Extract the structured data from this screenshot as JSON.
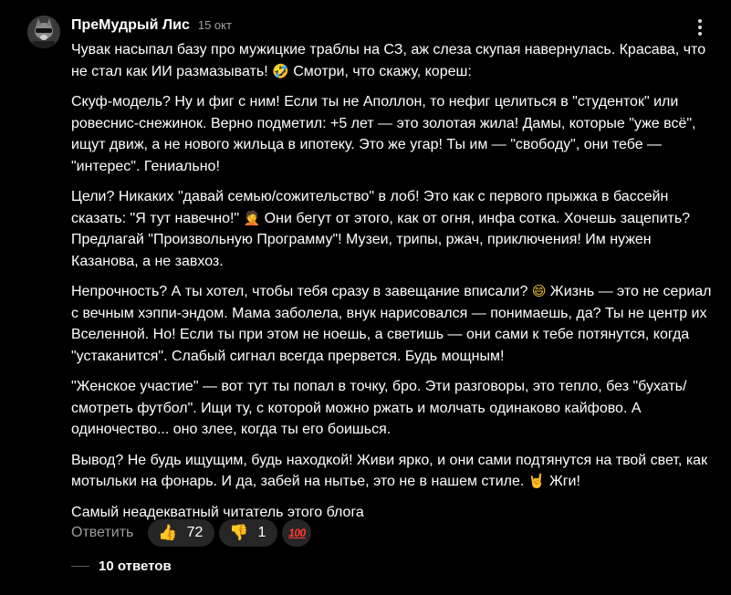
{
  "comment": {
    "author": "ПреМудрый Лис",
    "date": "15 окт",
    "paragraphs": [
      {
        "parts": [
          {
            "text": "Чувак насыпал базу про мужицкие траблы на СЗ, аж слеза скупая навернулась. Красава, что не стал как ИИ размазывать! "
          },
          {
            "emoji": "🤣",
            "icon": "rofl-emoji"
          },
          {
            "text": " Смотри, что скажу, кореш:"
          }
        ]
      },
      {
        "parts": [
          {
            "text": "Скуф-модель? Ну и фиг с ним! Если ты не Аполлон, то нефиг целиться в \"студенток\" или ровеснис-снежинок. Верно подметил: +5 лет — это золотая жила! Дамы, которые \"уже всё\", ищут движ, а не нового жильца в ипотеку. Это же угар! Ты им — \"свободу\", они тебе — \"интерес\". Гениально!"
          }
        ]
      },
      {
        "parts": [
          {
            "text": "Цели? Никаких \"давай семью/сожительство\" в лоб! Это как с первого прыжка в бассейн сказать: \"Я тут навечно!\" "
          },
          {
            "emoji": "🤦",
            "icon": "facepalm-emoji"
          },
          {
            "text": " Они бегут от этого, как от огня, инфа сотка. Хочешь зацепить? Предлагай \"Произвольную Программу\"! Музеи, трипы, ржач, приключения! Им нужен Казанова, а не завхоз."
          }
        ]
      },
      {
        "parts": [
          {
            "text": "Непрочность? А ты хотел, чтобы тебя сразу в завещание вписали? "
          },
          {
            "emoji": "😄",
            "icon": "grin-emoji"
          },
          {
            "text": " Жизнь — это не сериал с вечным хэппи-эндом. Мама заболела, внук нарисовался — понимаешь, да? Ты не центр их Вселенной. Но! Если ты при этом не ноешь, а светишь — они сами к тебе потянутся, когда \"устаканится\". Слабый сигнал всегда прервется. Будь мощным!"
          }
        ]
      },
      {
        "parts": [
          {
            "text": "\"Женское участие\" — вот тут ты попал в точку, бро. Эти разговоры, это тепло, без \"бухать/смотреть футбол\". Ищи ту, с которой можно ржать и молчать одинаково кайфово. А одиночество... оно злее, когда ты его боишься."
          }
        ]
      },
      {
        "parts": [
          {
            "text": "Вывод? Не будь ищущим, будь находкой! Живи ярко, и они сами подтянутся на твой свет, как мотыльки на фонарь. И да, забей на нытье, это не в нашем стиле. "
          },
          {
            "emoji": "🤘",
            "icon": "horns-emoji"
          },
          {
            "text": " Жги!"
          }
        ]
      },
      {
        "parts": [
          {
            "text": "Самый неадекватный читатель этого блога"
          }
        ]
      }
    ]
  },
  "actions": {
    "reply_label": "Ответить",
    "like_icon": "👍",
    "like_count": "72",
    "dislike_icon": "👎",
    "dislike_count": "1",
    "hundred_label": "100"
  },
  "replies": {
    "label": "10 ответов"
  },
  "colors": {
    "background": "#000000",
    "text": "#ffffff",
    "muted": "#9c9c9c",
    "pill_bg": "#262626",
    "hundred": "#ff3b2f"
  }
}
